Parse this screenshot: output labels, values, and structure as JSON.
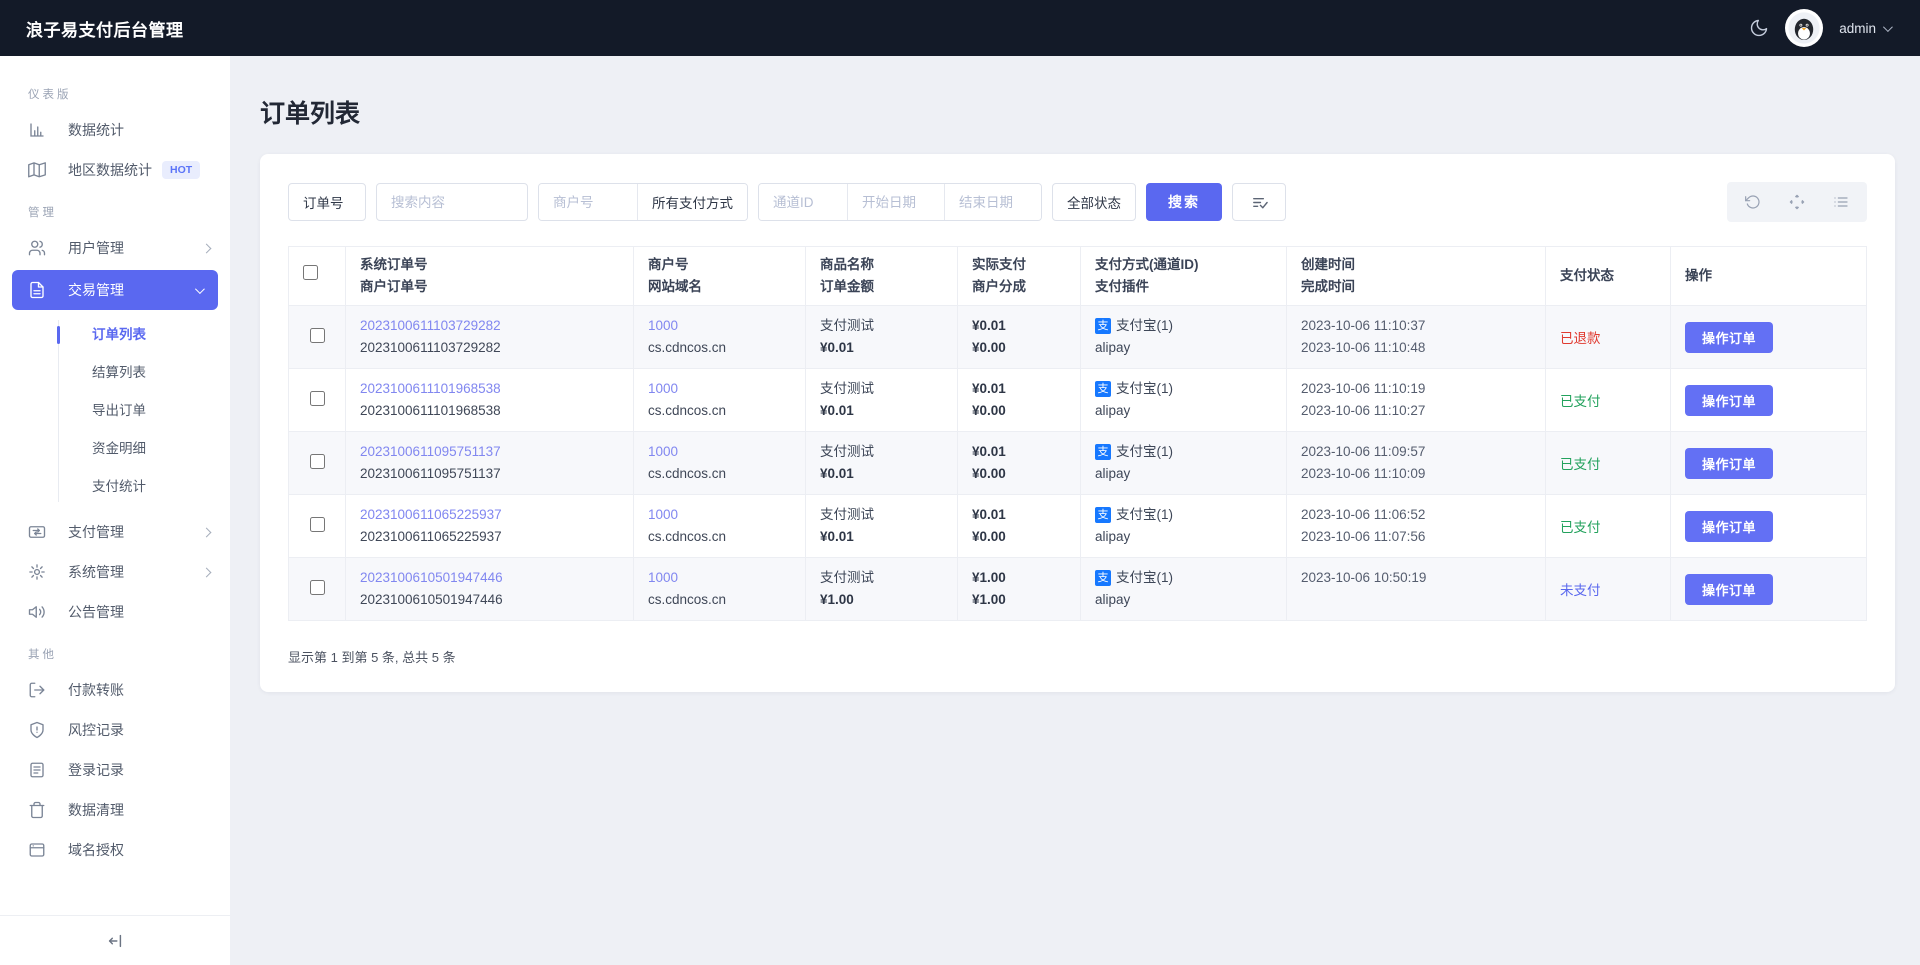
{
  "topbar": {
    "title": "浪子易支付后台管理",
    "username": "admin"
  },
  "sidebar": {
    "section_labels": [
      "仪表版",
      "管理",
      "其他"
    ],
    "items": {
      "stats": "数据统计",
      "region_stats": "地区数据统计",
      "hot_badge": "HOT",
      "user_mgmt": "用户管理",
      "trade_mgmt": "交易管理",
      "pay_mgmt": "支付管理",
      "sys_mgmt": "系统管理",
      "notice_mgmt": "公告管理",
      "transfer": "付款转账",
      "risk": "风控记录",
      "login_log": "登录记录",
      "data_clean": "数据清理",
      "domain_auth": "域名授权"
    },
    "submenu": [
      "订单列表",
      "结算列表",
      "导出订单",
      "资金明细",
      "支付统计"
    ]
  },
  "page": {
    "title": "订单列表"
  },
  "filters": {
    "order_field_select": "订单号",
    "search_placeholder": "搜索内容",
    "merchant_placeholder": "商户号",
    "pay_method_select": "所有支付方式",
    "channel_placeholder": "通道ID",
    "start_date_placeholder": "开始日期",
    "end_date_placeholder": "结束日期",
    "status_select": "全部状态",
    "search_button": "搜索"
  },
  "table": {
    "headers": [
      {
        "l1": "系统订单号",
        "l2": "商户订单号"
      },
      {
        "l1": "商户号",
        "l2": "网站域名"
      },
      {
        "l1": "商品名称",
        "l2": "订单金额"
      },
      {
        "l1": "实际支付",
        "l2": "商户分成"
      },
      {
        "l1": "支付方式(通道ID)",
        "l2": "支付插件"
      },
      {
        "l1": "创建时间",
        "l2": "完成时间"
      },
      {
        "l1": "支付状态"
      },
      {
        "l1": "操作"
      }
    ],
    "action_label": "操作订单",
    "rows": [
      {
        "sys_no": "2023100611103729282",
        "merch_no": "2023100611103729282",
        "merchant": "1000",
        "domain": "cs.cdncos.cn",
        "product": "支付测试",
        "amount": "¥0.01",
        "paid": "¥0.01",
        "share": "¥0.00",
        "method": "支付宝(1)",
        "plugin": "alipay",
        "created": "2023-10-06 11:10:37",
        "completed": "2023-10-06 11:10:48",
        "status": "已退款",
        "status_type": "refunded"
      },
      {
        "sys_no": "2023100611101968538",
        "merch_no": "2023100611101968538",
        "merchant": "1000",
        "domain": "cs.cdncos.cn",
        "product": "支付测试",
        "amount": "¥0.01",
        "paid": "¥0.01",
        "share": "¥0.00",
        "method": "支付宝(1)",
        "plugin": "alipay",
        "created": "2023-10-06 11:10:19",
        "completed": "2023-10-06 11:10:27",
        "status": "已支付",
        "status_type": "paid"
      },
      {
        "sys_no": "2023100611095751137",
        "merch_no": "2023100611095751137",
        "merchant": "1000",
        "domain": "cs.cdncos.cn",
        "product": "支付测试",
        "amount": "¥0.01",
        "paid": "¥0.01",
        "share": "¥0.00",
        "method": "支付宝(1)",
        "plugin": "alipay",
        "created": "2023-10-06 11:09:57",
        "completed": "2023-10-06 11:10:09",
        "status": "已支付",
        "status_type": "paid"
      },
      {
        "sys_no": "2023100611065225937",
        "merch_no": "2023100611065225937",
        "merchant": "1000",
        "domain": "cs.cdncos.cn",
        "product": "支付测试",
        "amount": "¥0.01",
        "paid": "¥0.01",
        "share": "¥0.00",
        "method": "支付宝(1)",
        "plugin": "alipay",
        "created": "2023-10-06 11:06:52",
        "completed": "2023-10-06 11:07:56",
        "status": "已支付",
        "status_type": "paid"
      },
      {
        "sys_no": "2023100610501947446",
        "merch_no": "2023100610501947446",
        "merchant": "1000",
        "domain": "cs.cdncos.cn",
        "product": "支付测试",
        "amount": "¥1.00",
        "paid": "¥1.00",
        "share": "¥1.00",
        "method": "支付宝(1)",
        "plugin": "alipay",
        "created": "2023-10-06 10:50:19",
        "completed": "",
        "status": "未支付",
        "status_type": "unpaid"
      }
    ]
  },
  "footer": {
    "summary": "显示第 1 到第 5 条, 总共 5 条"
  },
  "icons": {
    "alipay_glyph": "支"
  },
  "colors": {
    "accent": "#5a68f0",
    "topbar_bg": "#131a28",
    "status_paid": "#23a25d",
    "status_refunded": "#e03a30",
    "status_unpaid": "#5a68ee",
    "alipay_blue": "#1678ff"
  }
}
